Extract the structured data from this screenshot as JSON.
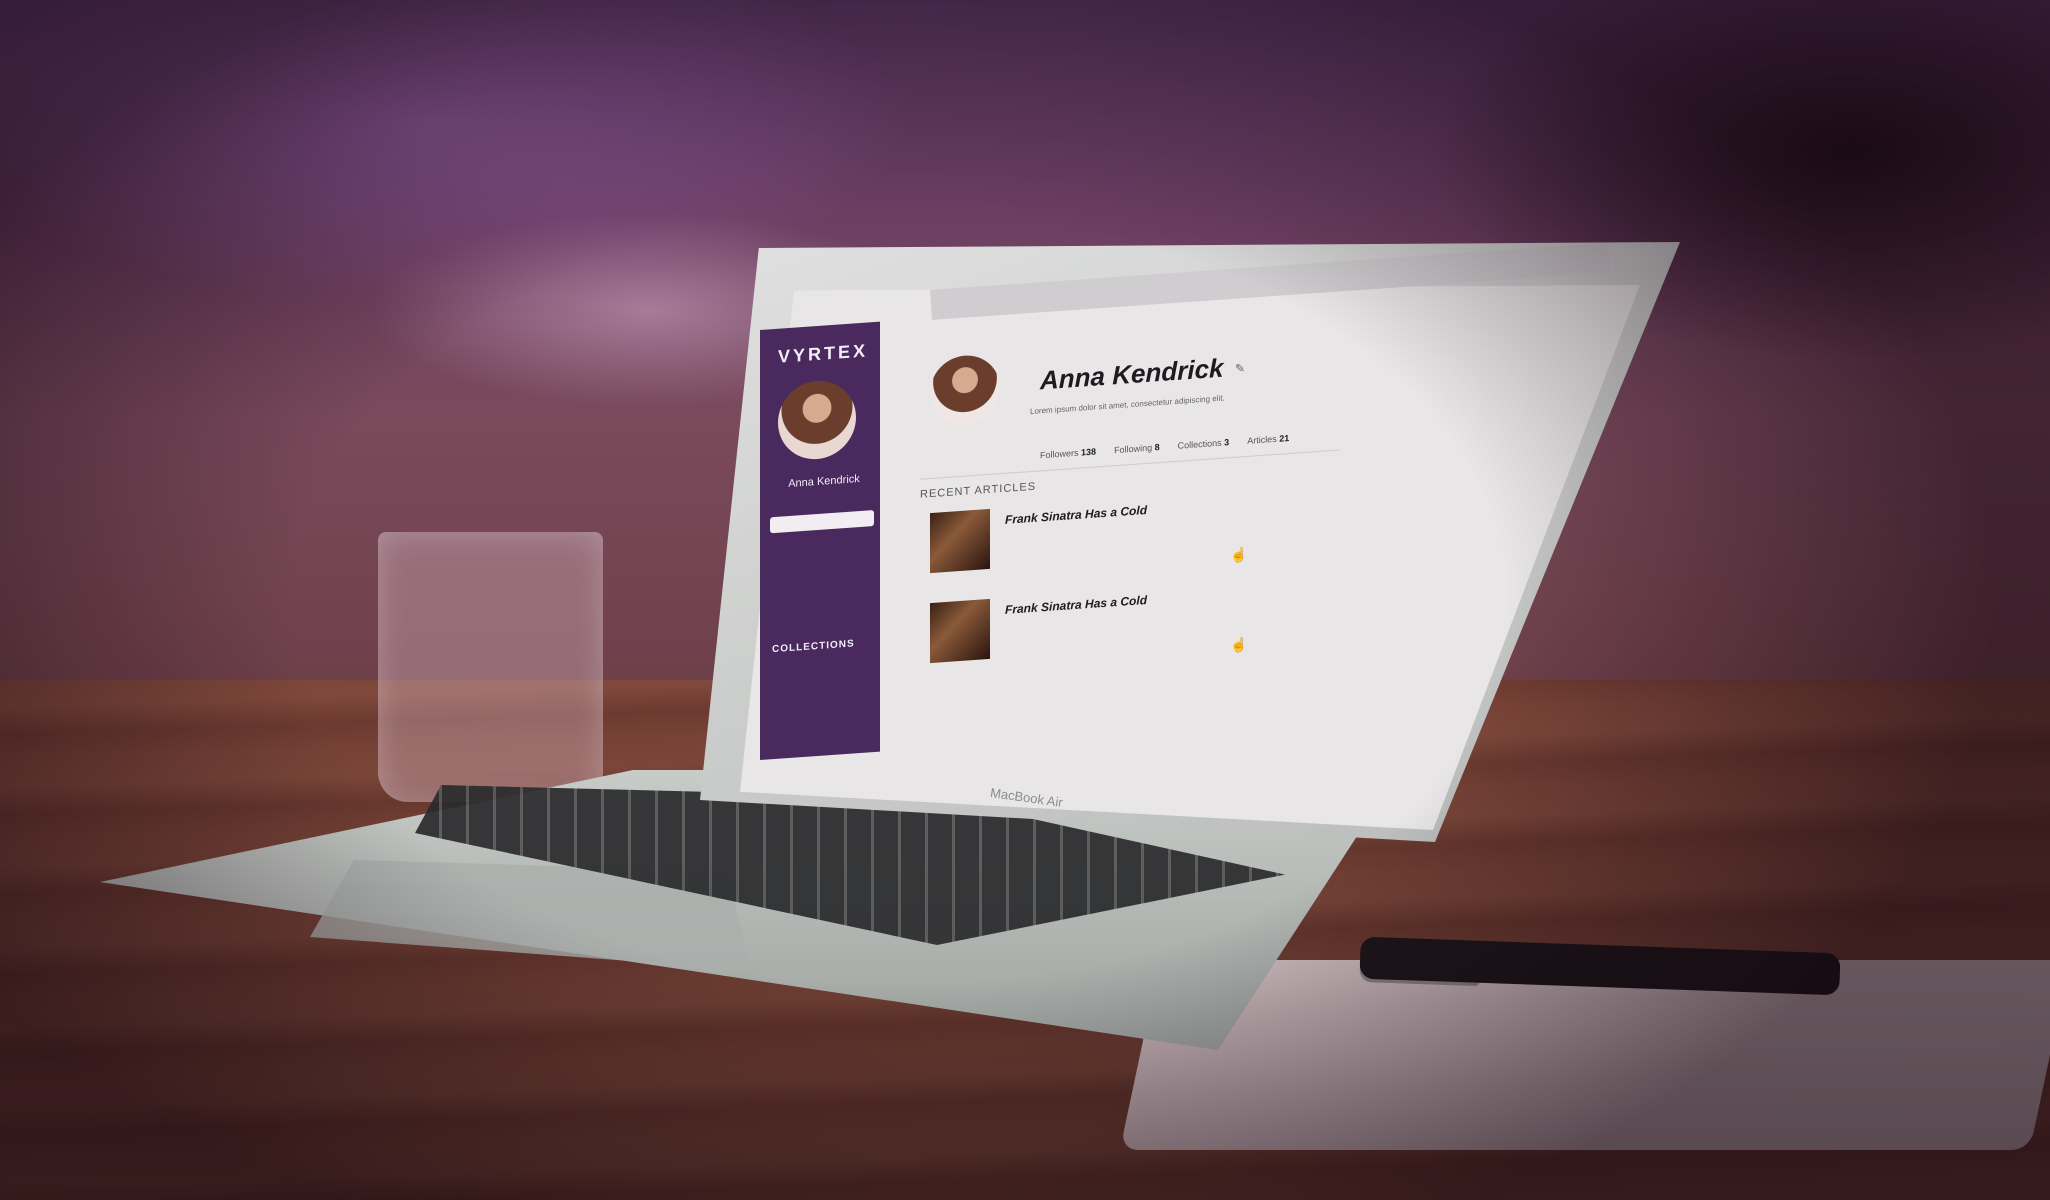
{
  "scene": {
    "colors": {
      "sidebar": "#4a2a5e",
      "table": "#7a4438",
      "background_purple": "#5e3a6a"
    }
  },
  "app": {
    "brand": "VYRTEX",
    "sidebar": {
      "user_name": "Anna Kendrick",
      "search_placeholder": "",
      "collections_label": "COLLECTIONS"
    },
    "profile": {
      "name": "Anna Kendrick",
      "bio": "Lorem ipsum dolor sit amet, consectetur adipiscing elit.",
      "stats": {
        "followers_label": "Followers",
        "followers_value": "138",
        "following_label": "Following",
        "following_value": "8",
        "collections_label": "Collections",
        "collections_value": "3",
        "articles_label": "Articles",
        "articles_value": "21"
      }
    },
    "recent_articles_label": "RECENT ARTICLES",
    "articles": [
      {
        "title": "Frank Sinatra Has a Cold"
      },
      {
        "title": "Frank Sinatra Has a Cold"
      }
    ]
  },
  "device": {
    "label": "MacBook Air"
  }
}
